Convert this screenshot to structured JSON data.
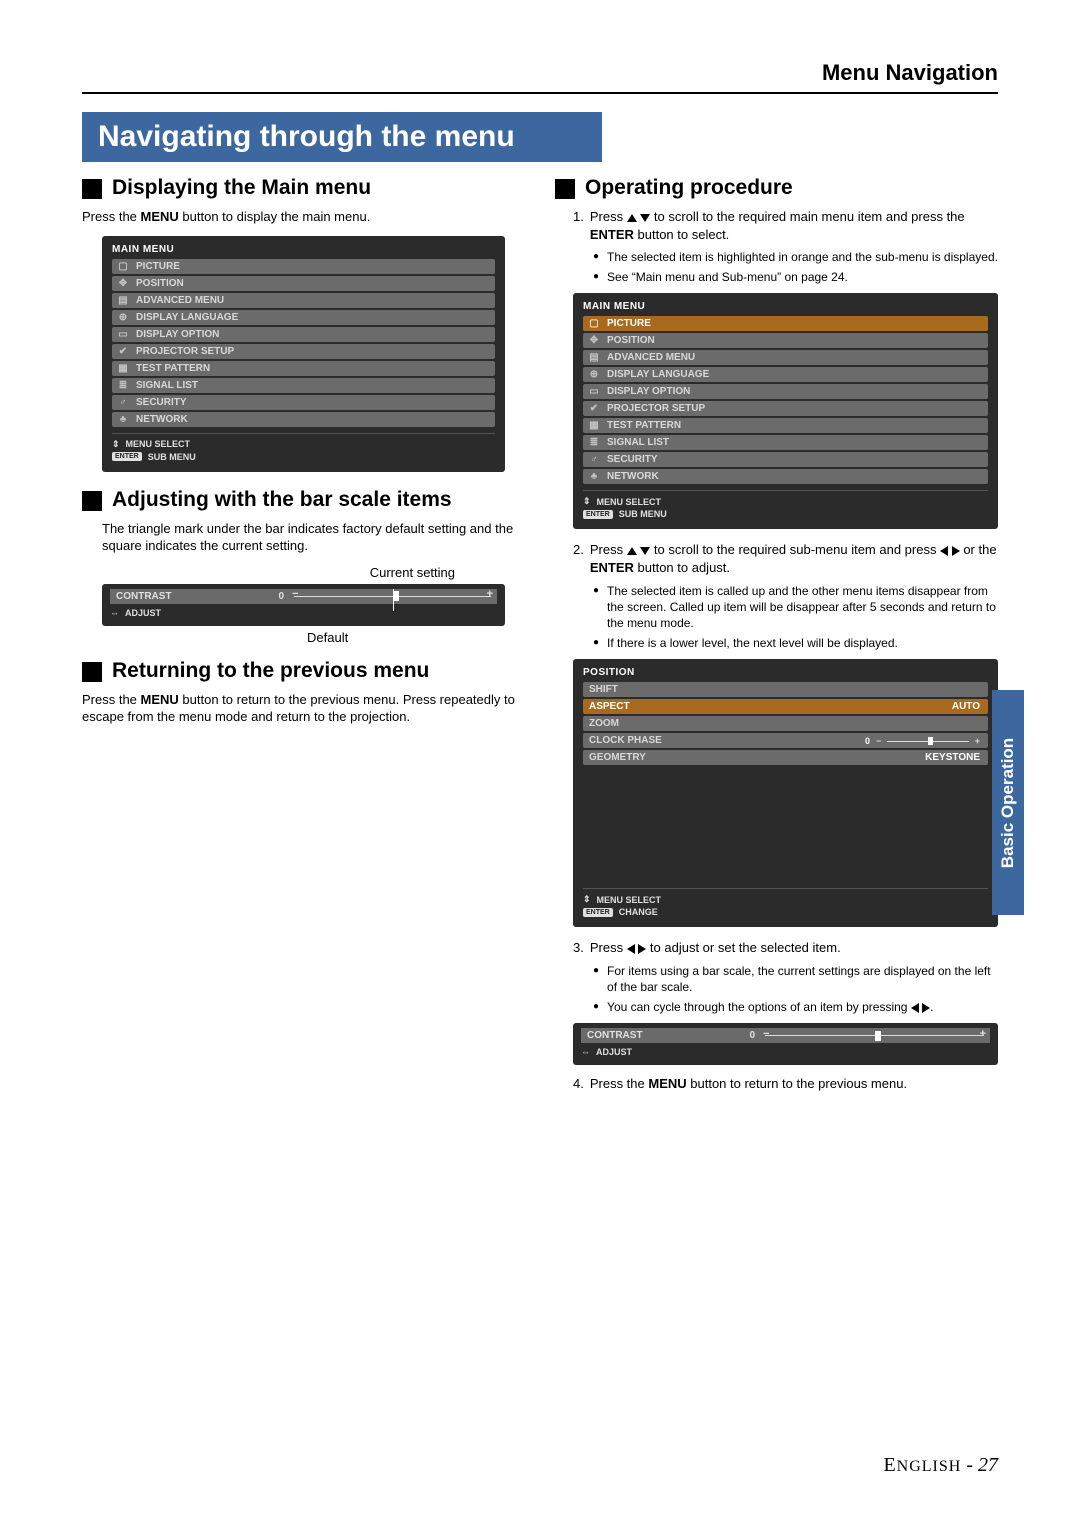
{
  "header": {
    "title": "Menu Navigation"
  },
  "banner": "Navigating through the menu",
  "left": {
    "s1": {
      "head": "Displaying the Main menu",
      "body": "Press the MENU button to display the main menu."
    },
    "s2": {
      "head": "Adjusting with the bar scale items",
      "body": "The triangle mark under the bar indicates factory default setting and the square indicates the current setting.",
      "current": "Current setting",
      "default": "Default"
    },
    "s3": {
      "head": "Returning to the previous menu",
      "body": "Press the MENU button to return to the previous menu. Press repeatedly to escape from the menu mode and return to the projection."
    }
  },
  "right": {
    "head": "Operating procedure",
    "step1": {
      "num": "1.",
      "text_a": "Press ",
      "text_b": " to scroll to the required main menu item and press the ",
      "text_c": "ENTER",
      "text_d": " button to select.",
      "b1": "The selected item is highlighted in orange and the sub-menu is displayed.",
      "b2": "See “Main menu and Sub-menu” on page 24."
    },
    "step2": {
      "num": "2.",
      "text_a": "Press ",
      "text_b": " to scroll to the required sub-menu item and press ",
      "text_c": " or the ",
      "text_d": "ENTER",
      "text_e": " button to adjust.",
      "b1": "The selected item is called up and the other menu items disappear from the screen. Called up item will be disappear after 5 seconds and return to the menu mode.",
      "b2": "If there is a lower level, the next level will be displayed."
    },
    "step3": {
      "num": "3.",
      "text_a": "Press ",
      "text_b": " to adjust or set the selected item.",
      "b1": "For items using a bar scale, the current settings are displayed on the left of the bar scale.",
      "b2_a": "You can cycle through the options of an item by pressing ",
      "b2_b": "."
    },
    "step4": {
      "num": "4.",
      "text_a": "Press the ",
      "text_b": "MENU",
      "text_c": " button to return to the previous menu."
    }
  },
  "main_menu": {
    "title": "MAIN MENU",
    "items": [
      {
        "icon": "▢",
        "label": "PICTURE"
      },
      {
        "icon": "✥",
        "label": "POSITION"
      },
      {
        "icon": "▤",
        "label": "ADVANCED MENU"
      },
      {
        "icon": "⊕",
        "label": "DISPLAY LANGUAGE"
      },
      {
        "icon": "▭",
        "label": "DISPLAY OPTION"
      },
      {
        "icon": "✔",
        "label": "PROJECTOR SETUP"
      },
      {
        "icon": "▦",
        "label": "TEST PATTERN"
      },
      {
        "icon": "≣",
        "label": "SIGNAL LIST"
      },
      {
        "icon": "♂",
        "label": "SECURITY"
      },
      {
        "icon": "♣",
        "label": "NETWORK"
      }
    ],
    "footer1": "MENU SELECT",
    "footer2_badge": "ENTER",
    "footer2": "SUB MENU"
  },
  "contrast_box": {
    "label": "CONTRAST",
    "value": "0",
    "adjust": "ADJUST"
  },
  "pos_menu": {
    "title": "POSITION",
    "items": [
      {
        "label": "SHIFT",
        "val": ""
      },
      {
        "label": "ASPECT",
        "val": "AUTO",
        "orange": true
      },
      {
        "label": "ZOOM",
        "val": ""
      },
      {
        "label": "CLOCK PHASE",
        "val": "0",
        "bar": true
      },
      {
        "label": "GEOMETRY",
        "val": "KEYSTONE"
      }
    ],
    "footer1": "MENU SELECT",
    "footer2_badge": "ENTER",
    "footer2": "CHANGE"
  },
  "side_tab": "Basic Operation",
  "footer": {
    "lang": "ENGLISH",
    "dash": " - ",
    "page": "27"
  }
}
